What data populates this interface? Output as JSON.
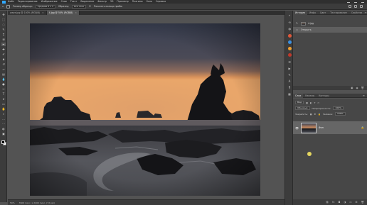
{
  "menubar": {
    "items": [
      "Файл",
      "Редактирование",
      "Изображение",
      "Слои",
      "Текст",
      "Выделение",
      "Фильтр",
      "3D",
      "Просмотр",
      "Плагины",
      "Окно",
      "Справка"
    ]
  },
  "options": {
    "sample_size_label": "Размер образца:",
    "sample_size_value": "Среднее 3 х 3",
    "sample_label": "Образец:",
    "sample_value": "Все слои",
    "show_ring_label": "Показать кольцо пробы"
  },
  "tabs": [
    {
      "label": "wave.jpg @ 100% (RGB/8)",
      "active": false
    },
    {
      "label": "4.jpg @ 50% (RGB/8)",
      "active": true
    }
  ],
  "status": {
    "zoom": "50%",
    "info": "3600 пикс. х 2400 пикс. (72 ppi)"
  },
  "history_panel": {
    "tabs": [
      "История",
      "Инфо",
      "Цвет",
      "Тестирование",
      "Свойства"
    ],
    "snapshot_label": "4.jpg",
    "step_label": "Открыть"
  },
  "layers_panel": {
    "tabs": [
      "Слои",
      "Каналы",
      "Контуры"
    ],
    "filter_label": "Вид",
    "blend_mode": "Обычные",
    "opacity_label": "Непрозрачность:",
    "opacity_value": "100%",
    "lock_label": "Закрепить:",
    "fill_label": "Заливка:",
    "fill_value": "100%",
    "layer_name": "Фон"
  },
  "colors": {
    "accent": "#31a8ff",
    "panel_bg": "#474747",
    "canvas_bg": "#535353"
  }
}
